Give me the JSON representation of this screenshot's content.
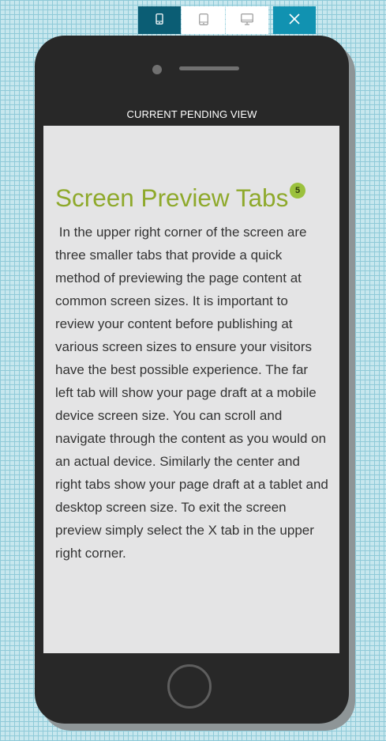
{
  "toolbar": {
    "tabs": [
      {
        "id": "mobile",
        "icon": "mobile-phone-icon",
        "active": true
      },
      {
        "id": "tablet",
        "icon": "tablet-icon",
        "active": false
      },
      {
        "id": "desktop",
        "icon": "desktop-monitor-icon",
        "active": false
      }
    ],
    "close_icon": "close-x-icon"
  },
  "device": {
    "view_label": "CURRENT PENDING VIEW"
  },
  "content": {
    "heading": "Screen Preview Tabs",
    "badge": "5",
    "body": " In the upper right corner of the screen are three smaller tabs that provide a quick method of previewing the page content at common screen sizes. It is important to review your content before publishing at various screen sizes to ensure your visitors have the best possible experience. The far left tab will show your page draft at a mobile device screen size. You can scroll and navigate through the content as you would on an actual device. Similarly the center and right tabs show your page draft at a tablet and desktop screen size. To exit the screen preview simply select the X tab in the upper right corner."
  },
  "colors": {
    "active_tab": "#0b5d74",
    "close_tab": "#1192b1",
    "heading": "#8ea92b",
    "badge": "#9bc13d",
    "phone_body": "#282828",
    "screen_bg": "#e4e4e5"
  }
}
